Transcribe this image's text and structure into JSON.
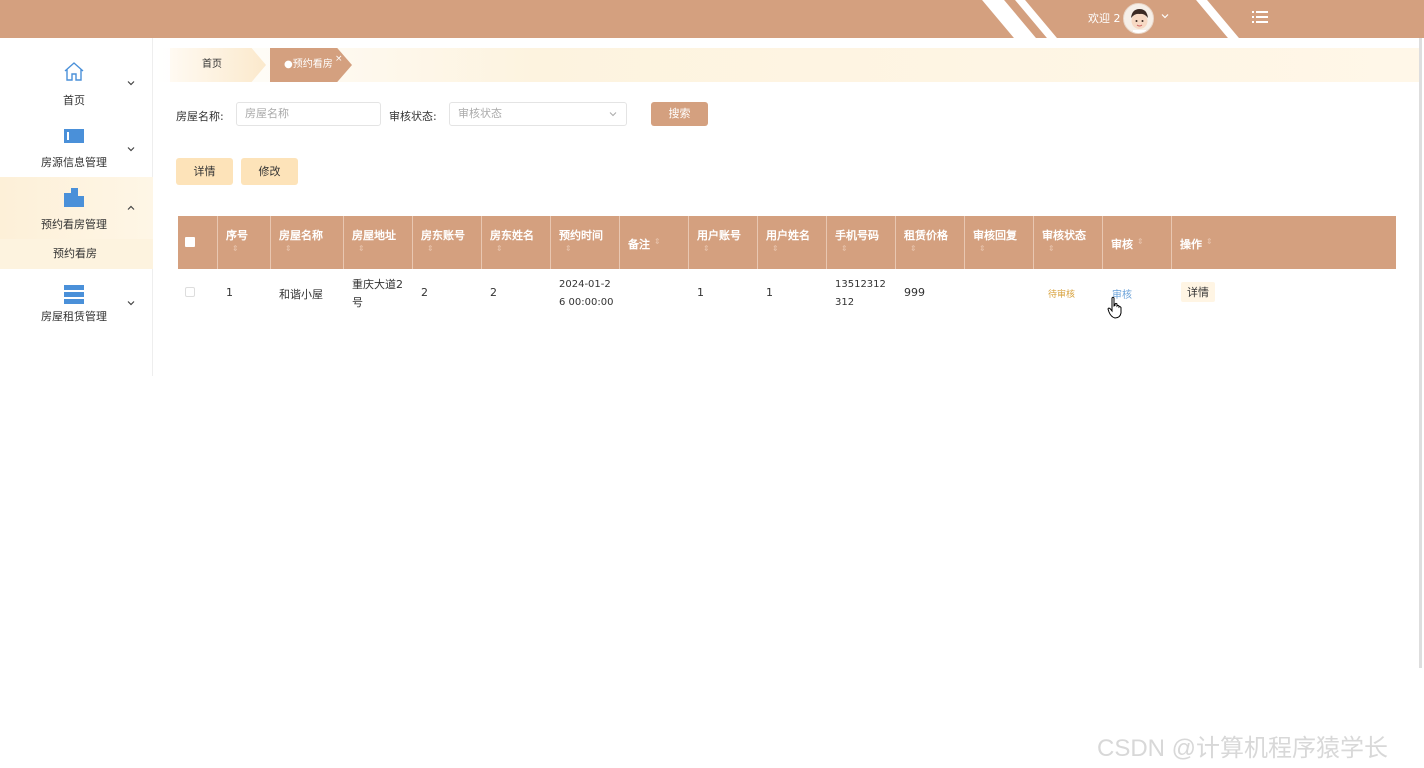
{
  "header": {
    "welcome_text": "欢迎 2",
    "brand_color": "#d4a07f"
  },
  "sidebar": {
    "items": [
      {
        "label": "首页",
        "icon": "home-icon"
      },
      {
        "label": "房源信息管理",
        "icon": "house-info-icon"
      },
      {
        "label": "预约看房管理",
        "icon": "building-icon",
        "active": true
      },
      {
        "label": "房屋租赁管理",
        "icon": "list-icon"
      }
    ],
    "sub_items": [
      {
        "label": "预约看房"
      }
    ]
  },
  "tabs": {
    "home": "首页",
    "active": "●预约看房",
    "close": "×"
  },
  "search": {
    "name_label": "房屋名称:",
    "name_placeholder": "房屋名称",
    "status_label": "审核状态:",
    "status_placeholder": "审核状态",
    "search_button": "搜索"
  },
  "actions": {
    "detail": "详情",
    "edit": "修改"
  },
  "table": {
    "columns": [
      "序号",
      "房屋名称",
      "房屋地址",
      "房东账号",
      "房东姓名",
      "预约时间",
      "备注",
      "用户账号",
      "用户姓名",
      "手机号码",
      "租赁价格",
      "审核回复",
      "审核状态",
      "审核",
      "操作"
    ],
    "sort_glyph": "⇕",
    "rows": [
      {
        "index": "1",
        "house_name": "和谐小屋",
        "address": "重庆大道2号",
        "landlord_account": "2",
        "landlord_name": "2",
        "appointment_time": "2024-01-26 00:00:00",
        "remark": "",
        "user_account": "1",
        "user_name": "1",
        "phone": "13512312312",
        "price": "999",
        "reply": "",
        "status": "待审核",
        "audit_link": "审核",
        "detail_button": "详情"
      }
    ]
  },
  "watermark": "CSDN @计算机程序猿学长",
  "colors": {
    "accent": "#d4a07f",
    "light_button": "#fde3b9",
    "pending_status": "#d9a441",
    "link": "#6aa1d8"
  }
}
